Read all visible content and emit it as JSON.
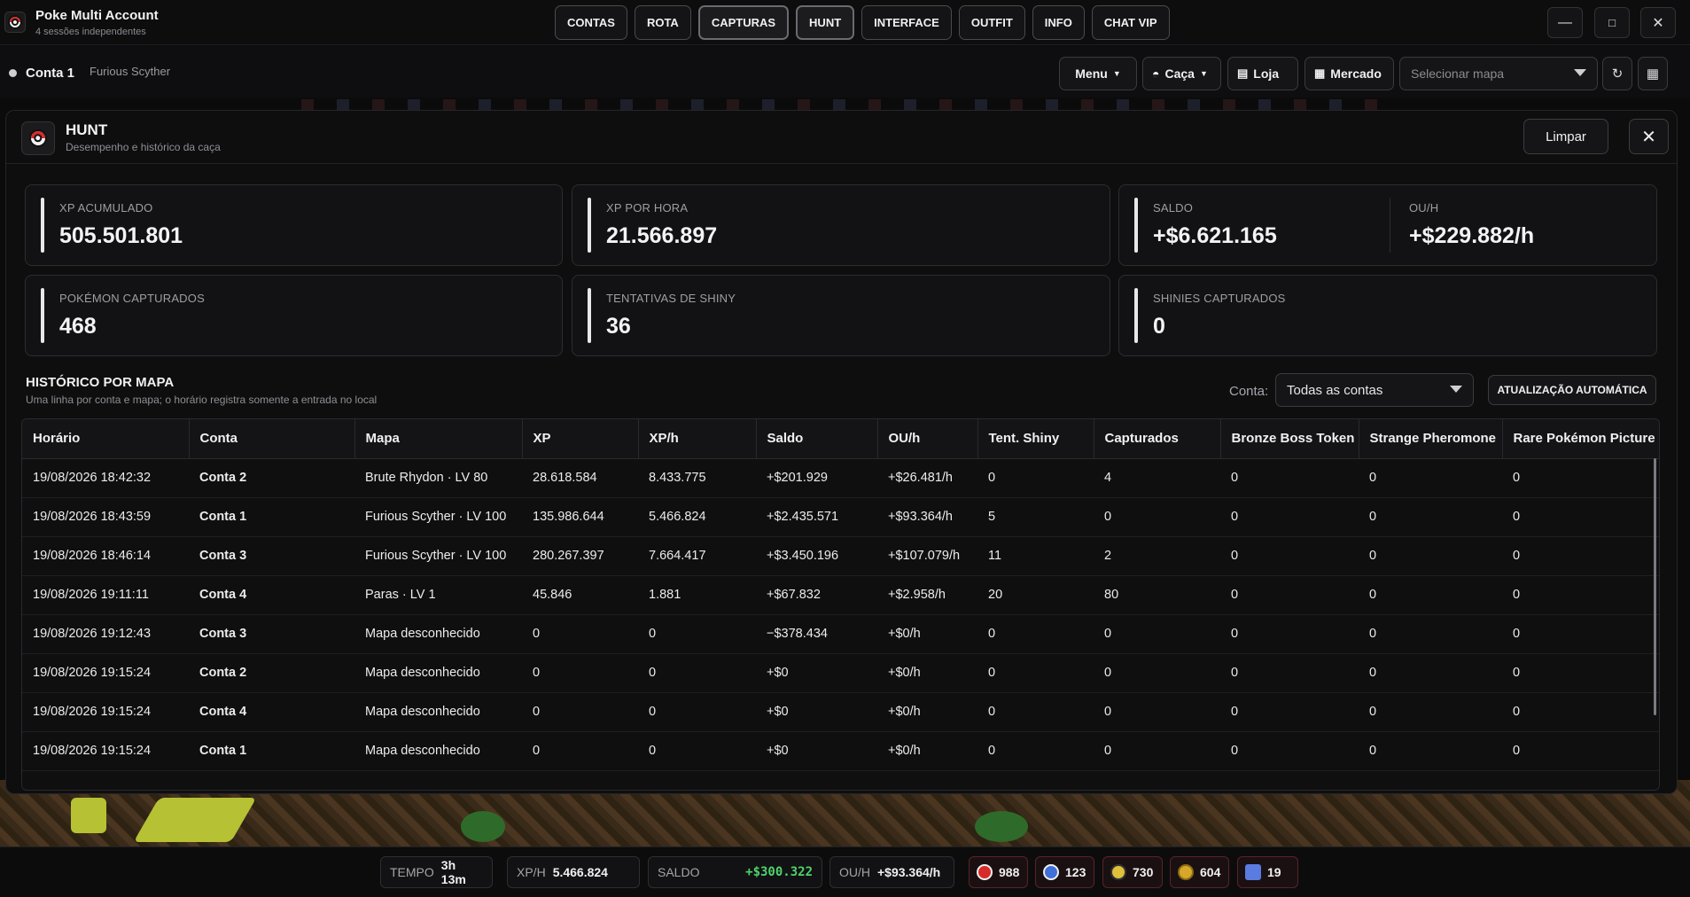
{
  "app": {
    "title": "Poke Multi Account",
    "subtitle": "4 sessões independentes"
  },
  "nav": {
    "items": [
      "CONTAS",
      "ROTA",
      "CAPTURAS",
      "HUNT",
      "INTERFACE",
      "OUTFIT",
      "INFO",
      "CHAT VIP"
    ],
    "active": "HUNT"
  },
  "window_controls": {
    "minimize": "—",
    "maximize": "□",
    "close": "✕"
  },
  "account": {
    "name": "Conta 1",
    "character": "Furious Scyther"
  },
  "toolbar": {
    "menu": "Menu",
    "caca": "Caça",
    "loja": "Loja",
    "mercado": "Mercado",
    "map_placeholder": "Selecionar mapa",
    "refresh": "↻",
    "grid": "▦"
  },
  "panel": {
    "title": "HUNT",
    "subtitle": "Desempenho e histórico da caça",
    "clear": "Limpar",
    "close": "✕"
  },
  "stats": {
    "xp_total": {
      "label": "XP ACUMULADO",
      "value": "505.501.801"
    },
    "xp_hour": {
      "label": "XP POR HORA",
      "value": "21.566.897"
    },
    "saldo": {
      "label": "SALDO",
      "value": "+$6.621.165"
    },
    "ou_h": {
      "label": "OU/H",
      "value": "+$229.882/h"
    },
    "captured": {
      "label": "POKÉMON CAPTURADOS",
      "value": "468"
    },
    "shiny_attempts": {
      "label": "TENTATIVAS DE SHINY",
      "value": "36"
    },
    "shinies": {
      "label": "SHINIES CAPTURADOS",
      "value": "0"
    }
  },
  "history": {
    "title": "HISTÓRICO POR MAPA",
    "subtitle": "Uma linha por conta e mapa; o horário registra somente a entrada no local",
    "filter_label": "Conta:",
    "filter_value": "Todas as contas",
    "auto_update": "ATUALIZAÇÃO AUTOMÁTICA",
    "columns": [
      "Horário",
      "Conta",
      "Mapa",
      "XP",
      "XP/h",
      "Saldo",
      "OU/h",
      "Tent. Shiny",
      "Capturados",
      "Bronze Boss Token",
      "Strange Pheromone",
      "Rare Pokémon Picture"
    ],
    "rows": [
      [
        "19/08/2026 18:42:32",
        "Conta 2",
        "Brute Rhydon · LV 80",
        "28.618.584",
        "8.433.775",
        "+$201.929",
        "+$26.481/h",
        "0",
        "4",
        "0",
        "0",
        "0"
      ],
      [
        "19/08/2026 18:43:59",
        "Conta 1",
        "Furious Scyther · LV 100",
        "135.986.644",
        "5.466.824",
        "+$2.435.571",
        "+$93.364/h",
        "5",
        "0",
        "0",
        "0",
        "0"
      ],
      [
        "19/08/2026 18:46:14",
        "Conta 3",
        "Furious Scyther · LV 100",
        "280.267.397",
        "7.664.417",
        "+$3.450.196",
        "+$107.079/h",
        "11",
        "2",
        "0",
        "0",
        "0"
      ],
      [
        "19/08/2026 19:11:11",
        "Conta 4",
        "Paras · LV 1",
        "45.846",
        "1.881",
        "+$67.832",
        "+$2.958/h",
        "20",
        "80",
        "0",
        "0",
        "0"
      ],
      [
        "19/08/2026 19:12:43",
        "Conta 3",
        "Mapa desconhecido",
        "0",
        "0",
        "−$378.434",
        "+$0/h",
        "0",
        "0",
        "0",
        "0",
        "0"
      ],
      [
        "19/08/2026 19:15:24",
        "Conta 2",
        "Mapa desconhecido",
        "0",
        "0",
        "+$0",
        "+$0/h",
        "0",
        "0",
        "0",
        "0",
        "0"
      ],
      [
        "19/08/2026 19:15:24",
        "Conta 4",
        "Mapa desconhecido",
        "0",
        "0",
        "+$0",
        "+$0/h",
        "0",
        "0",
        "0",
        "0",
        "0"
      ],
      [
        "19/08/2026 19:15:24",
        "Conta 1",
        "Mapa desconhecido",
        "0",
        "0",
        "+$0",
        "+$0/h",
        "0",
        "0",
        "0",
        "0",
        "0"
      ]
    ]
  },
  "statusbar": {
    "tempo": {
      "label": "TEMPO",
      "value": "3h 13m"
    },
    "xph": {
      "label": "XP/H",
      "value": "5.466.824"
    },
    "saldo": {
      "label": "SALDO",
      "value": "+$300.322"
    },
    "ouh": {
      "label": "OU/H",
      "value": "+$93.364/h"
    },
    "resources": [
      {
        "icon": "pokeball-icon",
        "value": "988",
        "color": "#d82a2a"
      },
      {
        "icon": "greatball-icon",
        "value": "123",
        "color": "#3f6fd8"
      },
      {
        "icon": "ultraball-icon",
        "value": "730",
        "color": "#e0c03a"
      },
      {
        "icon": "coin-icon",
        "value": "604",
        "color": "#d8a72a"
      },
      {
        "icon": "star-icon",
        "value": "19",
        "color": "#5a7be0"
      }
    ]
  },
  "colors": {
    "accent_green": "#4fd36a",
    "card_border": "#2d2d31",
    "pokeball_red": "#d82a2a"
  }
}
